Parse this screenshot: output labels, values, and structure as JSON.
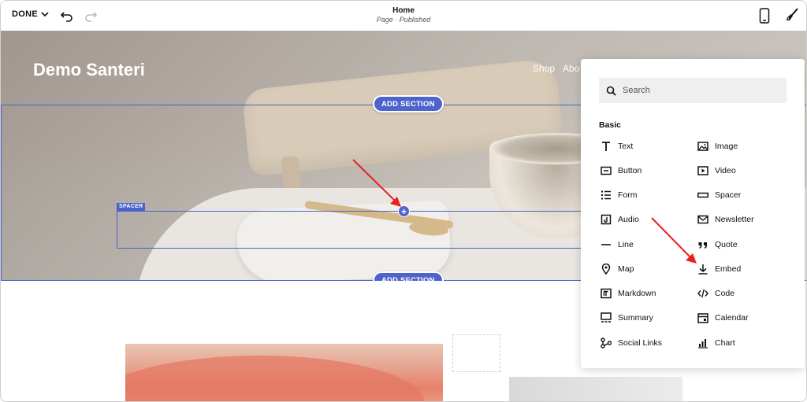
{
  "topbar": {
    "done_label": "DONE",
    "page_title": "Home",
    "page_status": "Page · Published"
  },
  "site": {
    "title": "Demo Santeri",
    "nav": [
      "Shop",
      "Abo"
    ]
  },
  "editor": {
    "add_section_label": "ADD SECTION",
    "spacer_label": "SPACER",
    "plus_label": "+"
  },
  "panel": {
    "search_placeholder": "Search",
    "heading": "Basic",
    "left_items": [
      {
        "label": "Text",
        "icon": "text-icon"
      },
      {
        "label": "Button",
        "icon": "button-icon"
      },
      {
        "label": "Form",
        "icon": "form-icon"
      },
      {
        "label": "Audio",
        "icon": "audio-icon"
      },
      {
        "label": "Line",
        "icon": "line-icon"
      },
      {
        "label": "Map",
        "icon": "map-icon"
      },
      {
        "label": "Markdown",
        "icon": "markdown-icon"
      },
      {
        "label": "Summary",
        "icon": "summary-icon"
      },
      {
        "label": "Social Links",
        "icon": "social-links-icon"
      }
    ],
    "right_items": [
      {
        "label": "Image",
        "icon": "image-icon"
      },
      {
        "label": "Video",
        "icon": "video-icon"
      },
      {
        "label": "Spacer",
        "icon": "spacer-icon"
      },
      {
        "label": "Newsletter",
        "icon": "newsletter-icon"
      },
      {
        "label": "Quote",
        "icon": "quote-icon"
      },
      {
        "label": "Embed",
        "icon": "embed-icon"
      },
      {
        "label": "Code",
        "icon": "code-icon"
      },
      {
        "label": "Calendar",
        "icon": "calendar-icon"
      },
      {
        "label": "Chart",
        "icon": "chart-icon"
      }
    ]
  },
  "colors": {
    "accent": "#4f63cc",
    "annotation_arrow": "#e8211f"
  }
}
